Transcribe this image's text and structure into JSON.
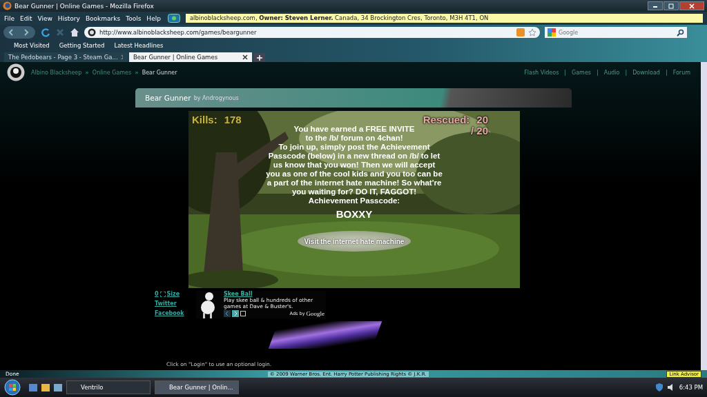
{
  "window": {
    "title": "Bear Gunner | Online Games - Mozilla Firefox"
  },
  "menu": [
    "File",
    "Edit",
    "View",
    "History",
    "Bookmarks",
    "Tools",
    "Help"
  ],
  "site_info": "albinoblacksheep.com, **Owner: Steven Lerner.** Canada, 34 Brockington Cres, Toronto, M3H 4T1, ON",
  "address_bar": {
    "url": "http://www.albinoblacksheep.com/games/beargunner"
  },
  "search": {
    "placeholder": "Google"
  },
  "bookmarks": [
    "Most Visited",
    "Getting Started",
    "Latest Headlines"
  ],
  "tabs": [
    {
      "label": "The Pedobears - Page 3 - Steam Ga...",
      "selected": false
    },
    {
      "label": "Bear Gunner | Online Games",
      "selected": true
    }
  ],
  "page": {
    "breadcrumb": [
      {
        "label": "Albino Blacksheep",
        "separator": "»"
      },
      {
        "label": "Online Games",
        "separator": "»"
      },
      {
        "label": "Bear Gunner"
      }
    ],
    "nav_links": [
      {
        "label": "Flash Videos",
        "separator": "|"
      },
      {
        "label": "Games",
        "separator": "|"
      },
      {
        "label": "Audio",
        "separator": "|"
      },
      {
        "label": "Download",
        "separator": "|"
      },
      {
        "label": "Forum"
      }
    ],
    "game_title": "Bear Gunner",
    "game_author": "by Androgynous",
    "game": {
      "kills_label": "Kills:",
      "kills": "178",
      "rescued_label": "Rescued:",
      "rescued": "20",
      "rescued_total": "/ 20",
      "message": "You have earned a FREE INVITE\nto the /b/ forum on 4chan!\nTo join up, simply post the Achievement\nPasscode (below) in a new thread on /b/ to let\nus know that you won! Then we will accept\nyou as one of the cool kids and you too can be\na part of the internet hate machine! So what're\nyou waiting for? DO IT, FAGGOT!",
      "passcode_label": "Achievement  Passcode:",
      "passcode": "BOXXY",
      "button": "Visit the internet hate machine"
    },
    "side_links": {
      "count": "0",
      "size": "Size",
      "links": [
        "Twitter",
        "Facebook"
      ]
    },
    "ad": {
      "title": "Skee Ball",
      "text": "Play skee ball & hundreds of other games at Dave & Buster's.",
      "ads_by": "Ads by",
      "brand": "Google"
    },
    "login_hint": "Click on \"Login\" to use an optional login."
  },
  "status_bar": {
    "status": "Done",
    "copyright": "© 2009 Warner Bros. Ent. Harry Potter Publishing Rights © J.K.R.",
    "link_advisor": "Link Advisor"
  },
  "taskbar": {
    "items": [
      {
        "label": "Ventrilo",
        "selected": false
      },
      {
        "label": "Bear Gunner | Onlin...",
        "selected": true
      }
    ],
    "clock": "6:43 PM"
  }
}
